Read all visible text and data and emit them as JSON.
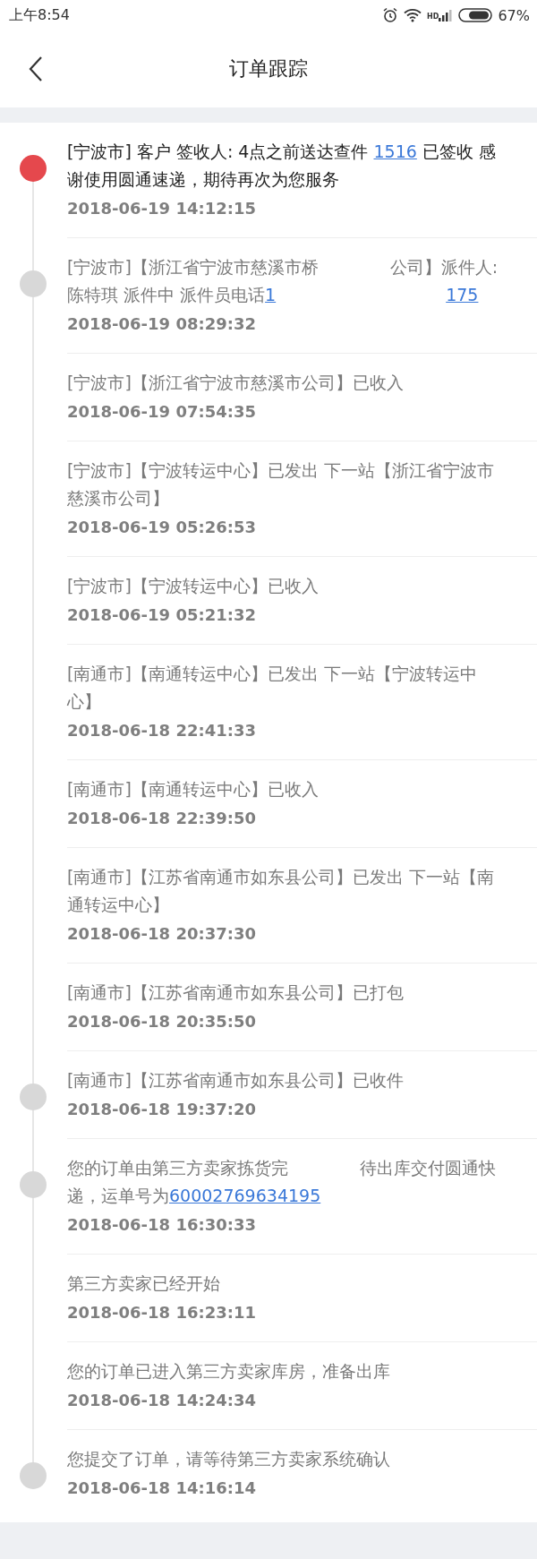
{
  "status_bar": {
    "time": "上午8:54",
    "signal_label": "HD",
    "battery": "67%"
  },
  "nav": {
    "title": "订单跟踪"
  },
  "events": [
    {
      "active": true,
      "kind": "signed",
      "segments": [
        {
          "kind": "text",
          "text": "[宁波市] 客户 签收人: 4点之前送达查件 "
        },
        {
          "kind": "link",
          "text": "1516"
        },
        {
          "kind": "text",
          "text": " 已签收 感谢使用圆通速递，期待再次为您服务"
        }
      ],
      "time": "2018-06-19 14:12:15"
    },
    {
      "active": false,
      "kind": "courier",
      "segments": [
        {
          "kind": "text",
          "text": "[宁波市]【浙江省宁波市慈溪市桥"
        },
        {
          "kind": "text",
          "text": "公司】派件人: 陈特琪 派件中 派件员电话"
        },
        {
          "kind": "link",
          "text": "1"
        },
        {
          "kind": "link",
          "text": "175"
        }
      ],
      "time": "2018-06-19 08:29:32"
    },
    {
      "active": false,
      "kind": "plain",
      "segments": [
        {
          "kind": "text",
          "text": "[宁波市]【浙江省宁波市慈溪市公司】已收入"
        }
      ],
      "time": "2018-06-19 07:54:35"
    },
    {
      "active": false,
      "kind": "plain",
      "segments": [
        {
          "kind": "text",
          "text": "[宁波市]【宁波转运中心】已发出 下一站【浙江省宁波市慈溪市公司】"
        }
      ],
      "time": "2018-06-19 05:26:53"
    },
    {
      "active": false,
      "kind": "plain",
      "segments": [
        {
          "kind": "text",
          "text": "[宁波市]【宁波转运中心】已收入"
        }
      ],
      "time": "2018-06-19 05:21:32"
    },
    {
      "active": false,
      "kind": "plain",
      "segments": [
        {
          "kind": "text",
          "text": "[南通市]【南通转运中心】已发出 下一站【宁波转运中心】"
        }
      ],
      "time": "2018-06-18 22:41:33"
    },
    {
      "active": false,
      "kind": "plain",
      "segments": [
        {
          "kind": "text",
          "text": "[南通市]【南通转运中心】已收入"
        }
      ],
      "time": "2018-06-18 22:39:50"
    },
    {
      "active": false,
      "kind": "plain",
      "segments": [
        {
          "kind": "text",
          "text": "[南通市]【江苏省南通市如东县公司】已发出 下一站【南通转运中心】"
        }
      ],
      "time": "2018-06-18 20:37:30"
    },
    {
      "active": false,
      "kind": "plain",
      "segments": [
        {
          "kind": "text",
          "text": "[南通市]【江苏省南通市如东县公司】已打包"
        }
      ],
      "time": "2018-06-18 20:35:50"
    },
    {
      "active": false,
      "kind": "truck",
      "segments": [
        {
          "kind": "text",
          "text": "[南通市]【江苏省南通市如东县公司】已收件"
        }
      ],
      "time": "2018-06-18 19:37:20"
    },
    {
      "active": false,
      "kind": "house",
      "segments": [
        {
          "kind": "text",
          "text": "您的订单由第三方卖家拣货完"
        },
        {
          "kind": "text",
          "text": "待出库交付圆通快递，运单号为"
        },
        {
          "kind": "link",
          "text": "60002769634195"
        }
      ],
      "time": "2018-06-18 16:30:33"
    },
    {
      "active": false,
      "kind": "plain",
      "segments": [
        {
          "kind": "text",
          "text": "第三方卖家已经开始"
        }
      ],
      "time": "2018-06-18 16:23:11"
    },
    {
      "active": false,
      "kind": "plain",
      "segments": [
        {
          "kind": "text",
          "text": "您的订单已进入第三方卖家库房，准备出库"
        }
      ],
      "time": "2018-06-18 14:24:34"
    },
    {
      "active": false,
      "kind": "clipboard",
      "segments": [
        {
          "kind": "text",
          "text": "您提交了订单，请等待第三方卖家系统确认"
        }
      ],
      "time": "2018-06-18 14:16:14"
    }
  ]
}
